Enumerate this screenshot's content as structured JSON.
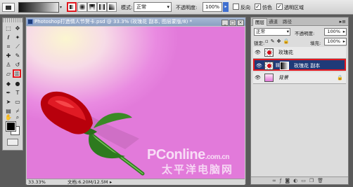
{
  "options_bar": {
    "mode_label": "模式:",
    "mode_value": "正常",
    "opacity_label": "不透明度:",
    "opacity_value": "100%",
    "reverse_label": "反向",
    "dither_label": "仿色",
    "transparency_label": "透明区域",
    "reverse_checked": false,
    "dither_checked": true,
    "transparency_checked": true,
    "active_gradient_type": "linear",
    "colors": {
      "highlight": "#e0161e"
    }
  },
  "toolbox": {
    "active_tool": "gradient-tool"
  },
  "document": {
    "title": "Photoshop打造情人节贺卡.psd @ 33.3% (玫瑰花 副本, 图层蒙版/8) *",
    "zoom": "33.33%",
    "doc_info": "文档:6.20M/12.5M",
    "watermark_main": "PConline",
    "watermark_suffix": ".com.cn",
    "watermark_cn": "太平洋电脑网"
  },
  "layers_panel": {
    "tabs": [
      "图层",
      "通道",
      "路径"
    ],
    "active_tab": "图层",
    "blend_mode": "正常",
    "opacity_label": "不透明度:",
    "opacity_value": "100%",
    "lock_label": "锁定:",
    "fill_label": "填充:",
    "fill_value": "100%",
    "layers": [
      {
        "name": "玫瑰花",
        "selected": false,
        "has_mask": false
      },
      {
        "name": "玫瑰花 副本",
        "selected": true,
        "has_mask": true
      },
      {
        "name": "背景",
        "selected": false,
        "locked": true
      }
    ]
  }
}
